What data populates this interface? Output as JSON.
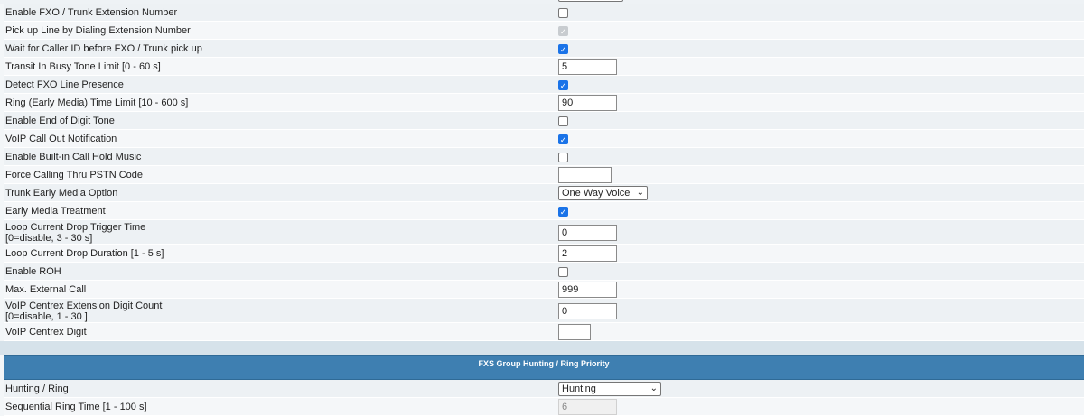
{
  "settings": {
    "rows": [
      {
        "label": "Enable FXO / Trunk Extension Number",
        "type": "checkbox",
        "checked": false
      },
      {
        "label": "Pick up Line by Dialing Extension Number",
        "type": "checkbox",
        "checked": true,
        "disabled": true
      },
      {
        "label": "Wait for Caller ID before FXO / Trunk pick up",
        "type": "checkbox",
        "checked": true
      },
      {
        "label": "Transit In Busy Tone Limit [0 - 60 s]",
        "type": "text",
        "value": "5"
      },
      {
        "label": "Detect FXO Line Presence",
        "type": "checkbox",
        "checked": true
      },
      {
        "label": "Ring (Early Media) Time Limit [10 - 600 s]",
        "type": "text",
        "value": "90"
      },
      {
        "label": "Enable End of Digit Tone",
        "type": "checkbox",
        "checked": false
      },
      {
        "label": "VoIP Call Out Notification",
        "type": "checkbox",
        "checked": true
      },
      {
        "label": "Enable Built-in Call Hold Music",
        "type": "checkbox",
        "checked": false
      },
      {
        "label": "Force Calling Thru PSTN Code",
        "type": "text",
        "value": ""
      },
      {
        "label": "Trunk Early Media Option",
        "type": "select",
        "value": "One Way Voice"
      },
      {
        "label": "Early Media Treatment",
        "type": "checkbox",
        "checked": true
      },
      {
        "label": "Loop Current Drop Trigger Time",
        "label2": "[0=disable, 3 - 30 s]",
        "type": "text",
        "value": "0"
      },
      {
        "label": "Loop Current Drop Duration [1 - 5 s]",
        "type": "text",
        "value": "2"
      },
      {
        "label": "Enable ROH",
        "type": "checkbox",
        "checked": false
      },
      {
        "label": "Max. External Call",
        "type": "text",
        "value": "999"
      },
      {
        "label": "VoIP Centrex Extension Digit Count",
        "label2": "[0=disable, 1 - 30 ]",
        "type": "text",
        "value": "0"
      },
      {
        "label": "VoIP Centrex Digit",
        "type": "text",
        "value": ""
      }
    ]
  },
  "fxs_section": {
    "title": "FXS Group Hunting / Ring Priority",
    "rows": [
      {
        "label": "Hunting / Ring",
        "type": "select",
        "value": "Hunting"
      },
      {
        "label": "Sequential Ring Time [1 - 100 s]",
        "type": "text",
        "value": "6",
        "disabled": true
      }
    ]
  },
  "colors": {
    "section_header": "#3e7fb1",
    "checkbox_checked": "#1a73e8"
  }
}
